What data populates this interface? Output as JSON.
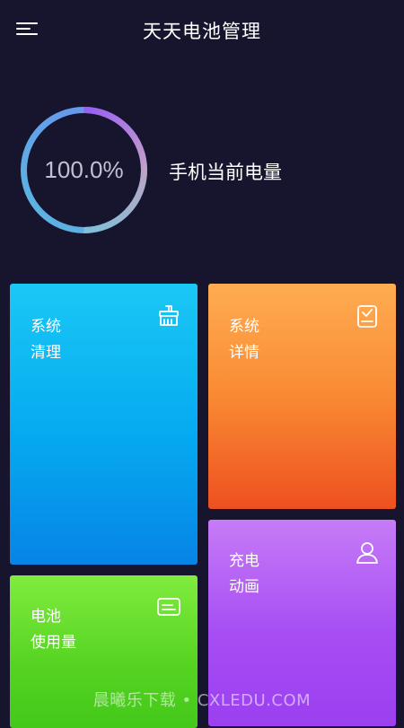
{
  "header": {
    "title": "天天电池管理",
    "menu_icon": "hamburger-menu-icon"
  },
  "battery": {
    "level_text": "100.0%",
    "level_fraction": 1.0,
    "label": "手机当前电量"
  },
  "cards": {
    "system_clean": {
      "line1": "系统",
      "line2": "清理",
      "icon": "broom-icon",
      "colors": [
        "#1ac8f5",
        "#0784e6"
      ]
    },
    "system_details": {
      "line1": "系统",
      "line2": "详情",
      "icon": "device-check-icon",
      "colors": [
        "#ffac52",
        "#ee5020"
      ]
    },
    "battery_usage": {
      "line1": "电池",
      "line2": "使用量",
      "icon": "chat-list-icon",
      "colors": [
        "#80ec3e",
        "#44c81a"
      ]
    },
    "charge_animation": {
      "line1": "充电",
      "line2": "动画",
      "icon": "user-icon",
      "colors": [
        "#c77bf7",
        "#9b3ff0"
      ]
    }
  },
  "watermark": "晨曦乐下载 • CXLEDU.COM",
  "colors": {
    "background": "#17152e",
    "gauge_start": "#9a5cf5",
    "gauge_end": "#5ac8e6"
  }
}
